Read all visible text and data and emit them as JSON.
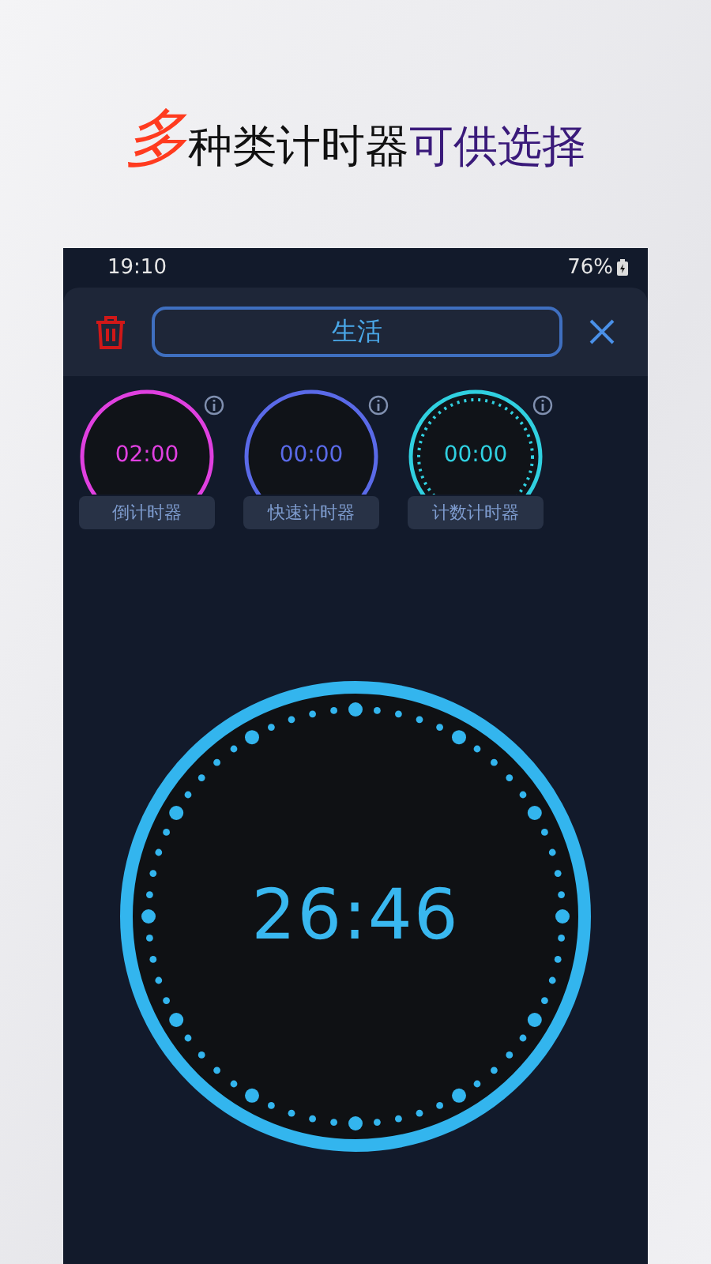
{
  "headline": [
    {
      "text": "多",
      "color": "#ff3b1f"
    },
    {
      "text": "种类计时器",
      "color": "#111111"
    },
    {
      "text": "可供选择",
      "color": "#3a1a7a"
    }
  ],
  "status_bar": {
    "time": "19:10",
    "battery": "76%"
  },
  "header": {
    "category": "生活"
  },
  "timers": [
    {
      "time": "02:00",
      "label": "倒计时器",
      "color": "#e040e0",
      "kind": "solid"
    },
    {
      "time": "00:00",
      "label": "快速计时器",
      "color": "#5a6ae8",
      "kind": "solid"
    },
    {
      "time": "00:00",
      "label": "计数计时器",
      "color": "#30d0e0",
      "kind": "dotted"
    }
  ],
  "clock": {
    "time": "26:46"
  }
}
